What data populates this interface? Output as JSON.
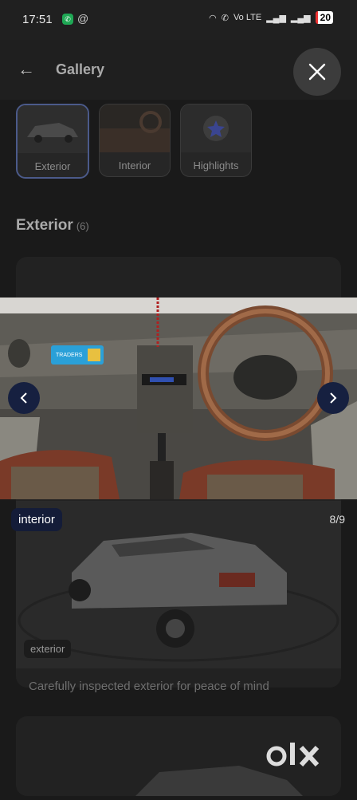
{
  "status_bar": {
    "time": "17:51",
    "whatsapp_icon": "whatsapp-icon",
    "at_icon": "@",
    "net_label": "Vo LTE",
    "battery": "20",
    "accent_battery": "#e33"
  },
  "header": {
    "title": "Gallery",
    "back_icon": "arrow-left-icon",
    "close_icon": "close-icon"
  },
  "tabs": [
    {
      "label": "Exterior",
      "active": true
    },
    {
      "label": "Interior",
      "active": false
    },
    {
      "label": "Highlights",
      "active": false
    }
  ],
  "section": {
    "title": "Exterior",
    "count": "(6)"
  },
  "card": {
    "badge": "exterior",
    "caption": "Carefully inspected exterior for peace of mind"
  },
  "viewer": {
    "tag": "interior",
    "counter": "8/9",
    "prev_icon": "chevron-left-icon",
    "next_icon": "chevron-right-icon",
    "sticker_text": "TRADERS"
  },
  "brand": {
    "logo": "olx"
  },
  "colors": {
    "accent_nav": "#162040",
    "pill": "#141c38"
  }
}
